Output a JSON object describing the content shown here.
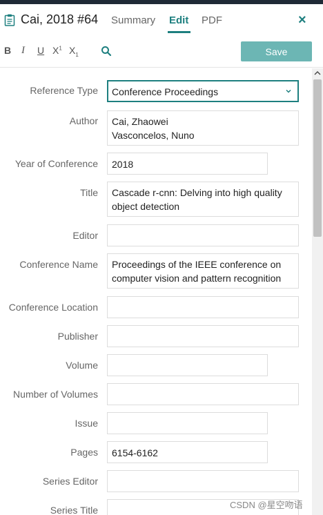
{
  "header": {
    "reference_title": "Cai, 2018 #64",
    "tabs": [
      "Summary",
      "Edit",
      "PDF"
    ],
    "active_tab": "Edit",
    "close_symbol": "×"
  },
  "toolbar": {
    "bold": "B",
    "italic": "I",
    "underline": "U",
    "superscript": "X",
    "superscript_mark": "1",
    "subscript": "X",
    "subscript_mark": "1",
    "search_icon": "search-icon",
    "save_label": "Save"
  },
  "colors": {
    "accent": "#1d7f7f",
    "save_button": "#6cb6b4",
    "topbar": "#1f2a36"
  },
  "fields": {
    "reference_type": {
      "label": "Reference Type",
      "value": "Conference Proceedings"
    },
    "author": {
      "label": "Author",
      "lines": [
        "Cai, Zhaowei",
        "Vasconcelos, Nuno"
      ]
    },
    "year": {
      "label": "Year of Conference",
      "value": "2018"
    },
    "title": {
      "label": "Title",
      "lines": [
        "Cascade r-cnn: Delving into high quality",
        "object detection"
      ]
    },
    "editor": {
      "label": "Editor",
      "value": ""
    },
    "conference_name": {
      "label": "Conference Name",
      "lines": [
        "Proceedings of the IEEE conference on",
        "computer vision and pattern recognition"
      ]
    },
    "conference_location": {
      "label": "Conference Location",
      "value": ""
    },
    "publisher": {
      "label": "Publisher",
      "value": ""
    },
    "volume": {
      "label": "Volume",
      "value": ""
    },
    "number_of_volumes": {
      "label": "Number of Volumes",
      "value": ""
    },
    "issue": {
      "label": "Issue",
      "value": ""
    },
    "pages": {
      "label": "Pages",
      "value": "6154-6162"
    },
    "series_editor": {
      "label": "Series Editor",
      "value": ""
    },
    "series_title": {
      "label": "Series Title",
      "value": ""
    }
  },
  "watermark": "CSDN @星空吻语"
}
